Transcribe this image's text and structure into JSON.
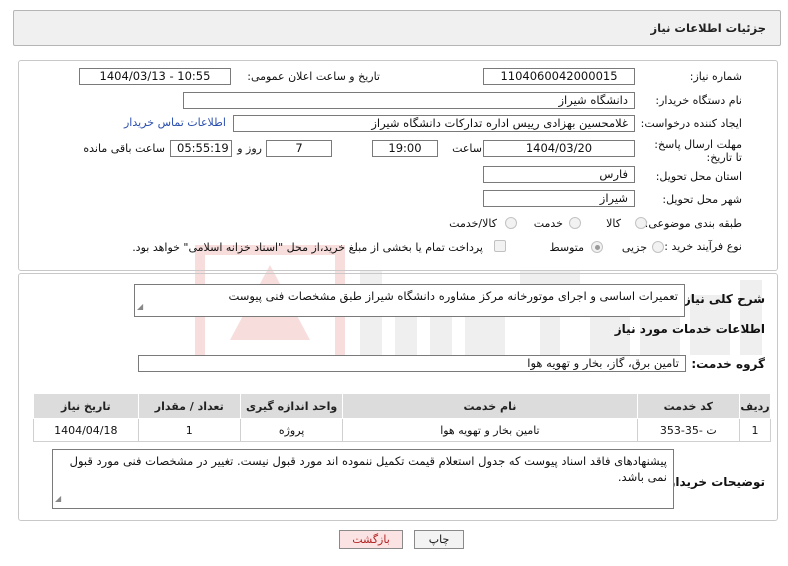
{
  "header": {
    "title": "جزئیات اطلاعات نیاز"
  },
  "form": {
    "need_number_label": "شماره نیاز:",
    "need_number_value": "1104060042000015",
    "announce_label": "تاریخ و ساعت اعلان عمومی:",
    "announce_value": "1404/03/13 - 10:55",
    "buyer_org_label": "نام دستگاه خریدار:",
    "buyer_org_value": "دانشگاه شیراز",
    "creator_label": "ایجاد کننده درخواست:",
    "creator_value": "غلامحسین بهزادی رییس اداره تدارکات دانشگاه شیراز",
    "contact_link": "اطلاعات تماس خریدار",
    "deadline_label": "مهلت ارسال پاسخ: تا تاریخ:",
    "deadline_date": "1404/03/20",
    "hour_label": "ساعت",
    "deadline_time": "19:00",
    "days_value": "7",
    "day_and_label": "روز و",
    "remaining_time": "05:55:19",
    "remaining_label": "ساعت باقی مانده",
    "province_label": "استان محل تحویل:",
    "province_value": "فارس",
    "city_label": "شهر محل تحویل:",
    "city_value": "شیراز",
    "category_label": "طبقه بندی موضوعی:",
    "category_options": [
      "کالا",
      "خدمت",
      "کالا/خدمت"
    ],
    "process_label": "نوع فرآیند خرید :",
    "process_options": [
      "جزیی",
      "متوسط"
    ],
    "payment_note": "پرداخت تمام یا بخشی از مبلغ خرید،از محل \"اسناد خزانه اسلامی\" خواهد بود."
  },
  "details": {
    "summary_label": "شرح کلی نیاز:",
    "summary_value": "تعمیرات اساسی و اجرای موتورخانه مرکز مشاوره دانشگاه شیراز طبق مشخصات فنی پیوست",
    "services_title": "اطلاعات خدمات مورد نیاز",
    "service_group_label": "گروه خدمت:",
    "service_group_value": "تامین برق، گاز، بخار و تهویه هوا",
    "table_headers": [
      "ردیف",
      "کد خدمت",
      "نام خدمت",
      "واحد اندازه گیری",
      "تعداد / مقدار",
      "تاریخ نیاز"
    ],
    "table_rows": [
      [
        "1",
        "ت -35-353",
        "تامین بخار و تهویه هوا",
        "پروژه",
        "1",
        "1404/04/18"
      ]
    ],
    "buyer_notes_label": "توضیحات خریدار:",
    "buyer_notes_value": "پیشنهادهای فاقد اسناد پیوست که جدول استعلام قیمت تکمیل ننموده اند مورد قبول نیست. تغییر در مشخصات فنی مورد قبول نمی باشد."
  },
  "buttons": {
    "print": "چاپ",
    "back": "بازگشت"
  },
  "colors": {
    "link": "#2b4fb0",
    "back_text": "#b22222",
    "back_bg": "#fbe3e3"
  }
}
